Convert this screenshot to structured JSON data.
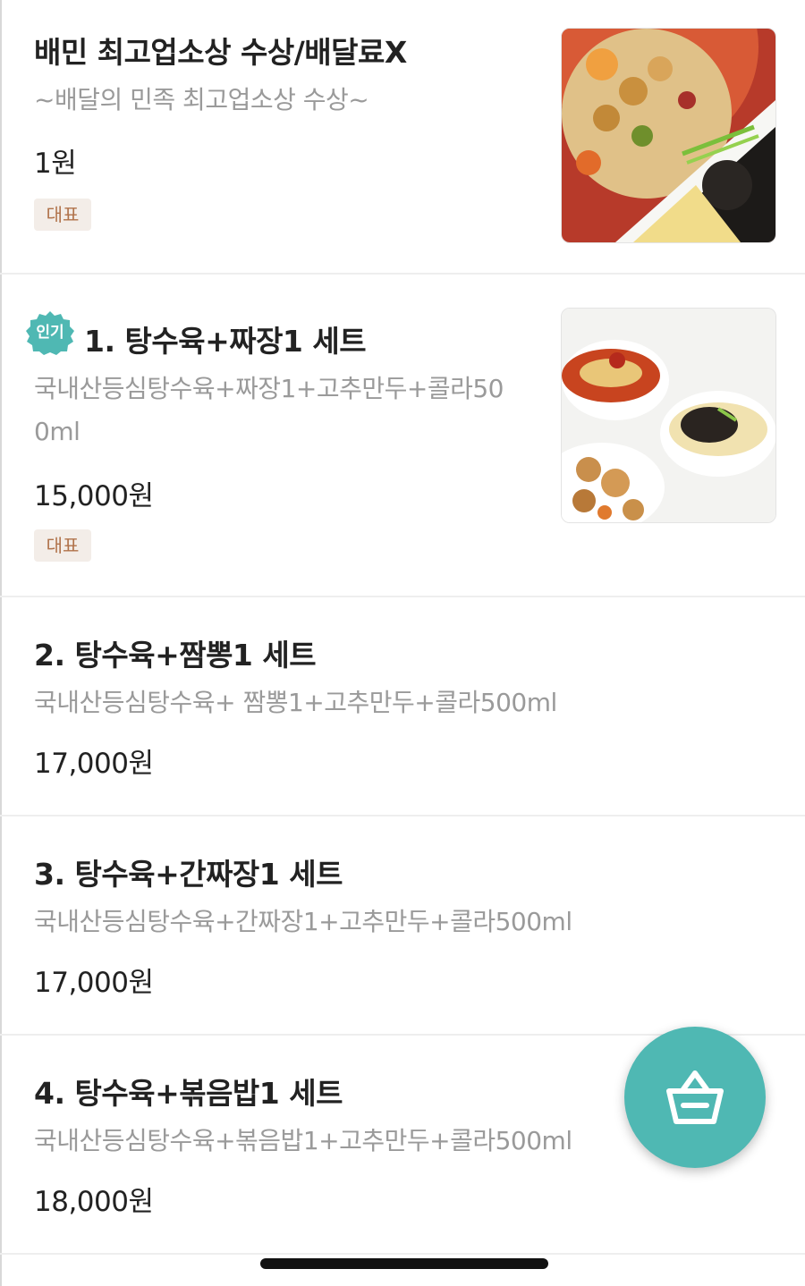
{
  "accent_color": "#4fb8b3",
  "badge_color": "#b0724a",
  "menu_items": [
    {
      "title": "배민 최고업소상 수상/배달료X",
      "desc": "~배달의 민족 최고업소상 수상~",
      "price": "1원",
      "badge": "대표",
      "image": "food-photo-sweet-sour-pork-and-jjajangmyeon"
    },
    {
      "popular_badge": "인기",
      "title": "1. 탕수육+짜장1 세트",
      "desc": "국내산등심탕수육+짜장1+고추만두+콜라500ml",
      "price": "15,000원",
      "badge": "대표",
      "image": "food-photo-jjamppong-jjajangmyeon-tangsuyuk"
    },
    {
      "title": "2. 탕수육+짬뽕1 세트",
      "desc": "국내산등심탕수육+ 짬뽕1+고추만두+콜라500ml",
      "price": "17,000원"
    },
    {
      "title": "3. 탕수육+간짜장1 세트",
      "desc": "국내산등심탕수육+간짜장1+고추만두+콜라500ml",
      "price": "17,000원"
    },
    {
      "title": "4. 탕수육+볶음밥1 세트",
      "desc": "국내산등심탕수육+볶음밥1+고추만두+콜라500ml",
      "price": "18,000원"
    }
  ],
  "cart_button": {
    "icon": "shopping-basket-icon"
  }
}
